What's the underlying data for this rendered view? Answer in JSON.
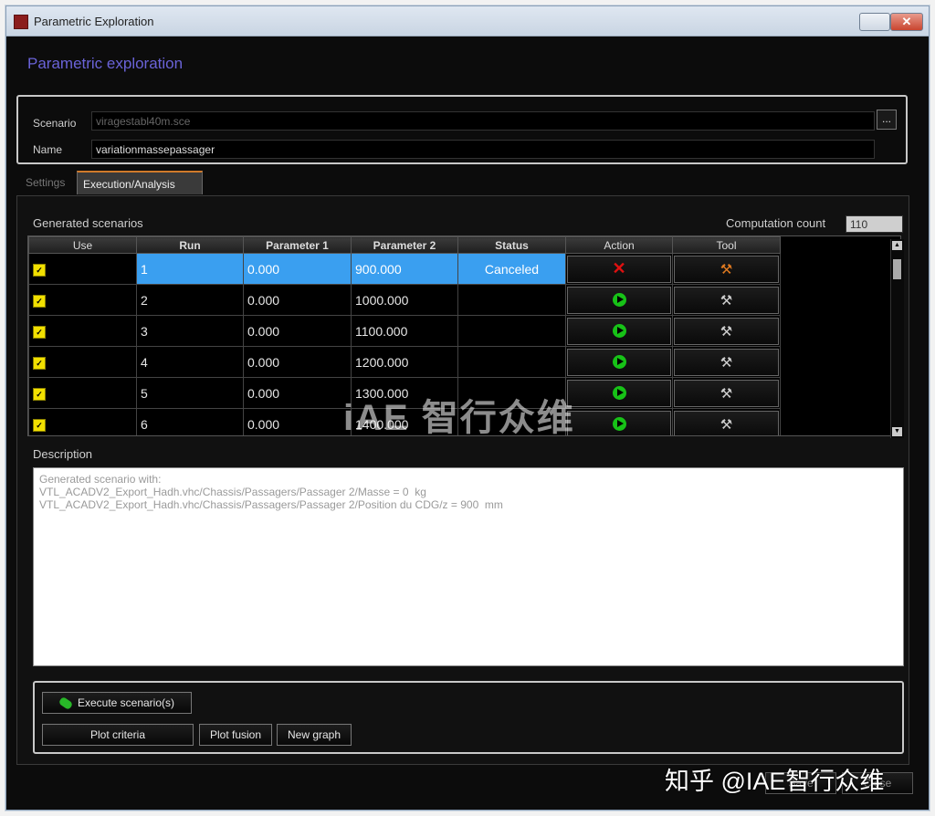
{
  "window": {
    "title": "Parametric Exploration",
    "close_glyph": "✕"
  },
  "heading": "Parametric exploration",
  "scenario": {
    "scenario_label": "Scenario",
    "scenario_value": "viragestabl40m.sce",
    "browse_label": "...",
    "name_label": "Name",
    "name_value": "variationmassepassager"
  },
  "tabs": [
    {
      "label": "Settings",
      "active": false
    },
    {
      "label": "Execution/Analysis",
      "active": true
    }
  ],
  "generated": {
    "title": "Generated scenarios",
    "computation_count_label": "Computation count",
    "computation_count_value": "110"
  },
  "table": {
    "columns": [
      "Use",
      "Run",
      "Parameter 1",
      "Parameter 2",
      "Status",
      "Action",
      "Tool"
    ],
    "rows": [
      {
        "use": true,
        "run": "1",
        "p1": "0.000",
        "p2": "900.000",
        "status": "Canceled",
        "action": "cancel-icon",
        "selected": true
      },
      {
        "use": true,
        "run": "2",
        "p1": "0.000",
        "p2": "1000.000",
        "status": "",
        "action": "play-icon",
        "selected": false
      },
      {
        "use": true,
        "run": "3",
        "p1": "0.000",
        "p2": "1100.000",
        "status": "",
        "action": "play-icon",
        "selected": false
      },
      {
        "use": true,
        "run": "4",
        "p1": "0.000",
        "p2": "1200.000",
        "status": "",
        "action": "play-icon",
        "selected": false
      },
      {
        "use": true,
        "run": "5",
        "p1": "0.000",
        "p2": "1300.000",
        "status": "",
        "action": "play-icon",
        "selected": false
      },
      {
        "use": true,
        "run": "6",
        "p1": "0.000",
        "p2": "1400.000",
        "status": "",
        "action": "play-icon",
        "selected": false
      }
    ]
  },
  "description": {
    "title": "Description",
    "lines": [
      "Generated scenario with:",
      "VTL_ACADV2_Export_Hadh.vhc/Chassis/Passagers/Passager 2/Masse = 0  kg",
      "VTL_ACADV2_Export_Hadh.vhc/Chassis/Passagers/Passager 2/Position du CDG/z = 900  mm"
    ]
  },
  "actions": {
    "execute": "Execute scenario(s)",
    "plot_criteria": "Plot criteria",
    "plot_fusion": "Plot fusion",
    "new_graph": "New graph"
  },
  "footer": {
    "save": "Save",
    "close": "Close"
  },
  "watermark": "iAE 智行众维",
  "corner_watermark": "知乎 @IAE智行众维",
  "colors": {
    "accent": "#6a63d8",
    "selection": "#3a9ff0",
    "check": "#f2e000",
    "play": "#17c217",
    "cancel": "#e01010",
    "tab_active_border": "#d07a2a"
  }
}
